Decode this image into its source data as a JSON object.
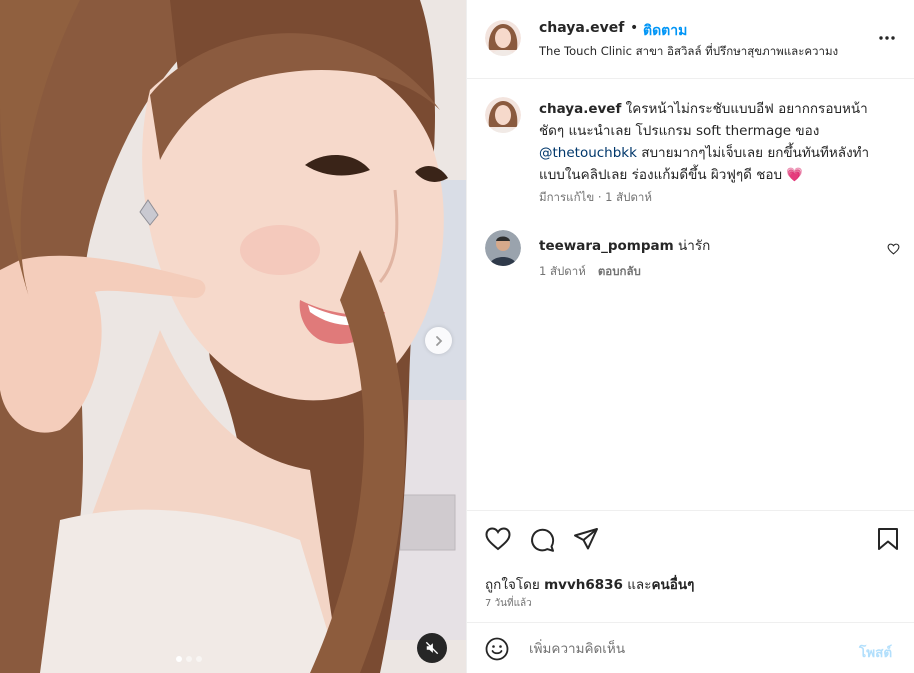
{
  "post": {
    "username": "chaya.evef",
    "separator": "•",
    "follow_label": "ติดตาม",
    "location": "The Touch Clinic สาขา อิสวิลล์ ที่ปรึกษาสุขภาพและความง",
    "more_icon": "more-horizontal-icon"
  },
  "caption": {
    "username": "chaya.evef",
    "text_1": "ใครหน้าไม่กระชับแบบอีฟ อยากกรอบหน้าชัดๆ แนะนำเลย โปรแกรม soft thermage ของ",
    "mention": "@thetouchbkk",
    "text_2": "สบายมากๆไม่เจ็บเลย ยกขึ้นทันทีหลังทำแบบในคลิปเลย ร่องแก้มดีขึ้น ผิวฟูๆดี ชอบ",
    "heart": "💗",
    "meta": "มีการแก้ไข · 1 สัปดาห์"
  },
  "comment": {
    "username": "teewara_pompam",
    "text": "น่ารัก",
    "time": "1 สัปดาห์",
    "reply_label": "ตอบกลับ"
  },
  "likes": {
    "prefix": "ถูกใจโดย",
    "user": "mvvh6836",
    "middle": "และ",
    "others": "คนอื่นๆ"
  },
  "posted_ago": "7 วันที่แล้ว",
  "composer": {
    "placeholder": "เพิ่มความคิดเห็น",
    "post_label": "โพสต์"
  },
  "carousel": {
    "slide_count": 3,
    "active_slide": 1
  },
  "colors": {
    "accent": "#0095f6",
    "mention": "#00376b",
    "muted": "#737373",
    "border": "#efefef"
  }
}
